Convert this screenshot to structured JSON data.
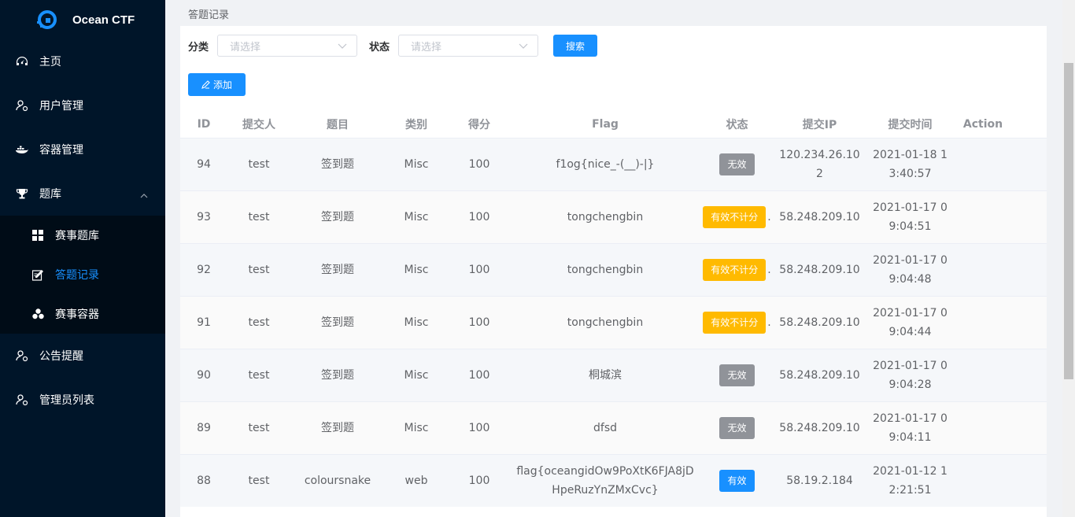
{
  "app": {
    "title": "Ocean CTF"
  },
  "sidebar": {
    "items": [
      {
        "label": "主页",
        "icon": "dashboard-icon"
      },
      {
        "label": "用户管理",
        "icon": "user-icon"
      },
      {
        "label": "容器管理",
        "icon": "docker-icon"
      },
      {
        "label": "题库",
        "icon": "trophy-icon"
      },
      {
        "label": "公告提醒",
        "icon": "user-icon"
      },
      {
        "label": "管理员列表",
        "icon": "user-icon"
      }
    ],
    "subitems": [
      {
        "label": "赛事题库",
        "icon": "grid-icon"
      },
      {
        "label": "答题记录",
        "icon": "edit-icon"
      },
      {
        "label": "赛事容器",
        "icon": "cubes-icon"
      }
    ]
  },
  "breadcrumb": "答题记录",
  "filters": {
    "category_label": "分类",
    "category_placeholder": "请选择",
    "status_label": "状态",
    "status_placeholder": "请选择",
    "search_label": "搜索",
    "add_label": "添加"
  },
  "table": {
    "headers": [
      "ID",
      "提交人",
      "题目",
      "类别",
      "得分",
      "Flag",
      "状态",
      "提交IP",
      "提交时间",
      "Action"
    ],
    "rows": [
      {
        "id": "94",
        "user": "test",
        "question": "签到题",
        "category": "Misc",
        "score": "100",
        "flag": "f1og{nice_-(__)-|}",
        "status": "无效",
        "status_color": "gray",
        "ip": "120.234.26.102",
        "time": "2021-01-18 13:40:57"
      },
      {
        "id": "93",
        "user": "test",
        "question": "签到题",
        "category": "Misc",
        "score": "100",
        "flag": "tongchengbin",
        "status": "有效不计分",
        "status_color": "orange",
        "ip": "58.248.209.10",
        "time": "2021-01-17 09:04:51"
      },
      {
        "id": "92",
        "user": "test",
        "question": "签到题",
        "category": "Misc",
        "score": "100",
        "flag": "tongchengbin",
        "status": "有效不计分",
        "status_color": "orange",
        "ip": "58.248.209.10",
        "time": "2021-01-17 09:04:48"
      },
      {
        "id": "91",
        "user": "test",
        "question": "签到题",
        "category": "Misc",
        "score": "100",
        "flag": "tongchengbin",
        "status": "有效不计分",
        "status_color": "orange",
        "ip": "58.248.209.10",
        "time": "2021-01-17 09:04:44"
      },
      {
        "id": "90",
        "user": "test",
        "question": "签到题",
        "category": "Misc",
        "score": "100",
        "flag": "桐城滨",
        "status": "无效",
        "status_color": "gray",
        "ip": "58.248.209.10",
        "time": "2021-01-17 09:04:28"
      },
      {
        "id": "89",
        "user": "test",
        "question": "签到题",
        "category": "Misc",
        "score": "100",
        "flag": "dfsd",
        "status": "无效",
        "status_color": "gray",
        "ip": "58.248.209.10",
        "time": "2021-01-17 09:04:11"
      },
      {
        "id": "88",
        "user": "test",
        "question": "coloursnake",
        "category": "web",
        "score": "100",
        "flag": "flag{oceangidOw9PoXtK6FJA8jDHpeRuzYnZMxCvc}",
        "status": "有效",
        "status_color": "blue",
        "ip": "58.19.2.184",
        "time": "2021-01-12 12:21:51"
      }
    ]
  },
  "colors": {
    "sidebar_bg": "#001529",
    "accent": "#1890ff",
    "warning": "#ffba00",
    "muted": "#909399"
  }
}
